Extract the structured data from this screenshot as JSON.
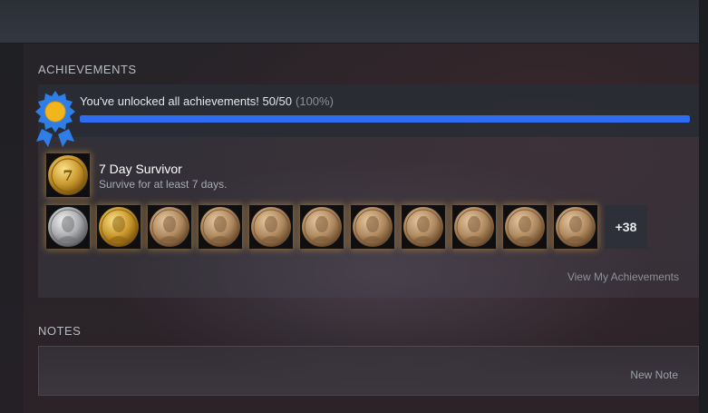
{
  "achievements": {
    "heading": "ACHIEVEMENTS",
    "progress": {
      "message": "You've unlocked all achievements! 50/50",
      "percent_label": "(100%)",
      "fraction": 1.0
    },
    "featured": {
      "name": "7 Day Survivor",
      "description": "Survive for at least 7 days."
    },
    "icons": [
      {
        "name": "silver-coin-icon",
        "metal": "silver"
      },
      {
        "name": "gold-coin-icon",
        "metal": "gold"
      },
      {
        "name": "bronze-coin-icon",
        "metal": "bronze"
      },
      {
        "name": "bronze-coin-icon",
        "metal": "bronze"
      },
      {
        "name": "bronze-coin-icon",
        "metal": "bronze"
      },
      {
        "name": "bronze-coin-icon",
        "metal": "bronze"
      },
      {
        "name": "bronze-coin-icon",
        "metal": "bronze"
      },
      {
        "name": "bronze-coin-icon",
        "metal": "bronze"
      },
      {
        "name": "bronze-coin-icon",
        "metal": "bronze"
      },
      {
        "name": "bronze-coin-icon",
        "metal": "bronze"
      },
      {
        "name": "bronze-coin-icon",
        "metal": "bronze"
      }
    ],
    "more_label": "+38",
    "view_link": "View My Achievements"
  },
  "notes": {
    "heading": "NOTES",
    "new_note_label": "New Note"
  },
  "colors": {
    "progress_fill": "#2f6cf1",
    "award_ribbon": "#2f7ee8",
    "award_medal": "#f3b51c"
  }
}
